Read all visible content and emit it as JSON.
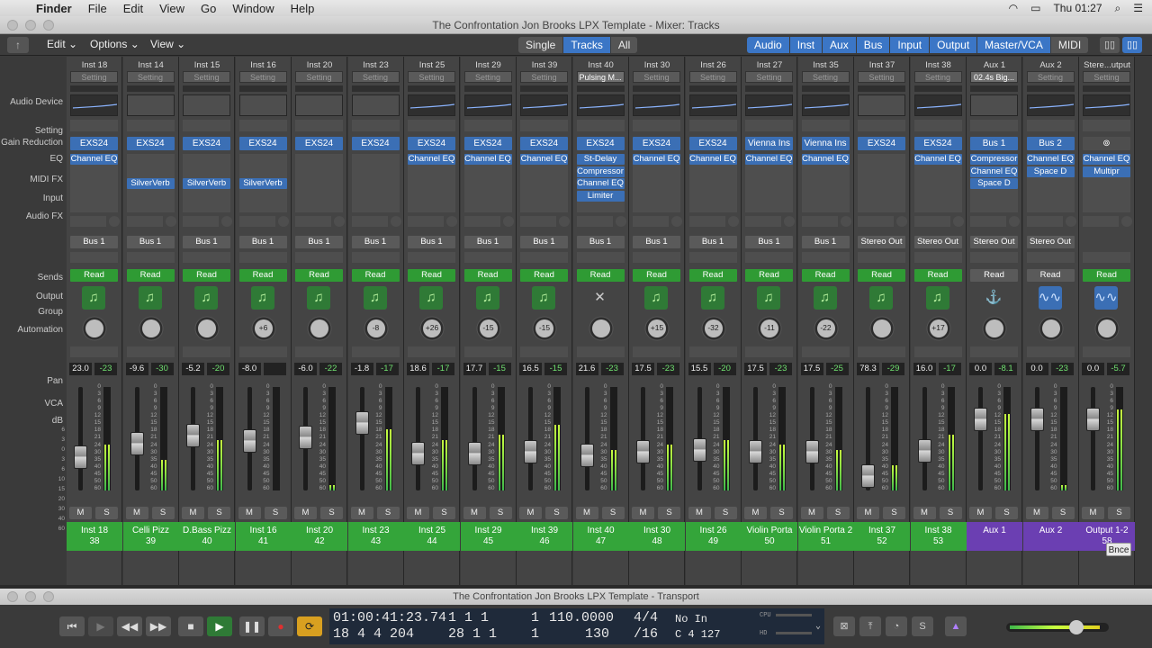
{
  "menubar": {
    "app": "Finder",
    "items": [
      "File",
      "Edit",
      "View",
      "Go",
      "Window",
      "Help"
    ],
    "clock": "Thu 01:27"
  },
  "mixer": {
    "window_title": "The Confrontation Jon Brooks LPX Template - Mixer: Tracks",
    "toolbar": {
      "edit": "Edit",
      "options": "Options",
      "view": "View",
      "modes": [
        "Single",
        "Tracks",
        "All"
      ],
      "active_mode": "Tracks",
      "filters": [
        "Audio",
        "Inst",
        "Aux",
        "Bus",
        "Input",
        "Output",
        "Master/VCA",
        "MIDI"
      ]
    },
    "row_labels": {
      "audio_device": "Audio Device",
      "setting": "Setting",
      "gain_reduction": "Gain Reduction",
      "eq": "EQ",
      "midi_fx": "MIDI FX",
      "input": "Input",
      "audio_fx": "Audio FX",
      "sends": "Sends",
      "output": "Output",
      "group": "Group",
      "automation": "Automation",
      "pan": "Pan",
      "vca": "VCA",
      "db": "dB"
    },
    "fader_scale": [
      "6",
      "3",
      "0",
      "3",
      "6",
      "10",
      "15",
      "20",
      "30",
      "40",
      "60"
    ],
    "meter_scale": [
      "0",
      "3",
      "6",
      "9",
      "12",
      "15",
      "18",
      "21",
      "24",
      "30",
      "35",
      "40",
      "45",
      "50",
      "60"
    ],
    "strips": [
      {
        "name": "Inst 18",
        "setting": "Setting",
        "eq": true,
        "input": "EXS24",
        "fx": [
          "Channel EQ"
        ],
        "output": "Bus 1",
        "automation": "Read",
        "icon": "note",
        "pan": "",
        "db": "23.0",
        "peak": "-23",
        "track": "Inst 18",
        "num": "38",
        "kind": "inst",
        "fader": 0.72,
        "meter": 0.45
      },
      {
        "name": "Inst 14",
        "setting": "Setting",
        "eq": false,
        "input": "EXS24",
        "fx": [
          "",
          "",
          "SilverVerb"
        ],
        "output": "Bus 1",
        "automation": "Read",
        "icon": "note",
        "pan": "",
        "db": "-9.6",
        "peak": "-30",
        "track": "Celli Pizz",
        "num": "39",
        "kind": "inst",
        "fader": 0.55,
        "meter": 0.3
      },
      {
        "name": "Inst 15",
        "setting": "Setting",
        "eq": false,
        "input": "EXS24",
        "fx": [
          "",
          "",
          "SilverVerb"
        ],
        "output": "Bus 1",
        "automation": "Read",
        "icon": "note",
        "pan": "",
        "db": "-5.2",
        "peak": "-20",
        "track": "D.Bass Pizz",
        "num": "40",
        "kind": "inst",
        "fader": 0.45,
        "meter": 0.5
      },
      {
        "name": "Inst 16",
        "setting": "Setting",
        "eq": false,
        "input": "EXS24",
        "fx": [
          "",
          "",
          "SilverVerb"
        ],
        "output": "Bus 1",
        "automation": "Read",
        "icon": "note",
        "pan": "+6",
        "db": "-8.0",
        "peak": "",
        "track": "Inst 16",
        "num": "41",
        "kind": "inst",
        "fader": 0.52,
        "meter": 0.0
      },
      {
        "name": "Inst 20",
        "setting": "Setting",
        "eq": false,
        "input": "EXS24",
        "fx": [],
        "output": "Bus 1",
        "automation": "Read",
        "icon": "note",
        "pan": "",
        "db": "-6.0",
        "peak": "-22",
        "track": "Inst 20",
        "num": "42",
        "kind": "inst",
        "fader": 0.48,
        "meter": 0.05
      },
      {
        "name": "Inst 23",
        "setting": "Setting",
        "eq": false,
        "input": "EXS24",
        "fx": [],
        "output": "Bus 1",
        "automation": "Read",
        "icon": "note",
        "pan": "-8",
        "db": "-1.8",
        "peak": "-17",
        "track": "Inst 23",
        "num": "43",
        "kind": "inst",
        "fader": 0.3,
        "meter": 0.6
      },
      {
        "name": "Inst 25",
        "setting": "Setting",
        "eq": true,
        "input": "EXS24",
        "fx": [
          "Channel EQ"
        ],
        "output": "Bus 1",
        "automation": "Read",
        "icon": "note",
        "pan": "+26",
        "db": "18.6",
        "peak": "-17",
        "track": "Inst 25",
        "num": "44",
        "kind": "inst",
        "fader": 0.68,
        "meter": 0.5
      },
      {
        "name": "Inst 29",
        "setting": "Setting",
        "eq": true,
        "input": "EXS24",
        "fx": [
          "Channel EQ"
        ],
        "output": "Bus 1",
        "automation": "Read",
        "icon": "note",
        "pan": "-15",
        "db": "17.7",
        "peak": "-15",
        "track": "Inst 29",
        "num": "45",
        "kind": "inst",
        "fader": 0.68,
        "meter": 0.55
      },
      {
        "name": "Inst 39",
        "setting": "Setting",
        "eq": true,
        "input": "EXS24",
        "fx": [
          "Channel EQ"
        ],
        "output": "Bus 1",
        "automation": "Read",
        "icon": "note",
        "pan": "-15",
        "db": "16.5",
        "peak": "-15",
        "track": "Inst 39",
        "num": "46",
        "kind": "inst",
        "fader": 0.66,
        "meter": 0.65
      },
      {
        "name": "Inst 40",
        "setting": "Pulsing M...",
        "eq": true,
        "input": "EXS24",
        "fx": [
          "St-Delay",
          "Compressor",
          "Channel EQ",
          "Limiter"
        ],
        "output": "Bus 1",
        "automation": "Read",
        "icon": "mute",
        "pan": "",
        "db": "21.6",
        "peak": "-23",
        "track": "Inst 40",
        "num": "47",
        "kind": "inst",
        "fader": 0.7,
        "meter": 0.4
      },
      {
        "name": "Inst 30",
        "setting": "Setting",
        "eq": true,
        "input": "EXS24",
        "fx": [
          "Channel EQ"
        ],
        "output": "Bus 1",
        "automation": "Read",
        "icon": "note",
        "pan": "+15",
        "db": "17.5",
        "peak": "-23",
        "track": "Inst 30",
        "num": "48",
        "kind": "inst",
        "fader": 0.66,
        "meter": 0.45
      },
      {
        "name": "Inst 26",
        "setting": "Setting",
        "eq": true,
        "input": "EXS24",
        "fx": [
          "Channel EQ"
        ],
        "output": "Bus 1",
        "automation": "Read",
        "icon": "note",
        "pan": "-32",
        "db": "15.5",
        "peak": "-20",
        "track": "Inst 26",
        "num": "49",
        "kind": "inst",
        "fader": 0.63,
        "meter": 0.5
      },
      {
        "name": "Inst 27",
        "setting": "Setting",
        "eq": true,
        "input": "Vienna Ins",
        "fx": [
          "Channel EQ"
        ],
        "output": "Bus 1",
        "automation": "Read",
        "icon": "note",
        "pan": "-11",
        "db": "17.5",
        "peak": "-23",
        "track": "Violin Porta",
        "num": "50",
        "kind": "inst",
        "fader": 0.66,
        "meter": 0.45
      },
      {
        "name": "Inst 35",
        "setting": "Setting",
        "eq": true,
        "input": "Vienna Ins",
        "fx": [
          "Channel EQ"
        ],
        "output": "Bus 1",
        "automation": "Read",
        "icon": "note",
        "pan": "-22",
        "db": "17.5",
        "peak": "-25",
        "track": "Violin Porta 2",
        "num": "51",
        "kind": "inst",
        "fader": 0.66,
        "meter": 0.4
      },
      {
        "name": "Inst 37",
        "setting": "Setting",
        "eq": false,
        "input": "EXS24",
        "fx": [],
        "output": "Stereo Out",
        "automation": "Read",
        "icon": "note",
        "pan": "",
        "db": "78.3",
        "peak": "-29",
        "track": "Inst 37",
        "num": "52",
        "kind": "inst",
        "fader": 0.95,
        "meter": 0.25
      },
      {
        "name": "Inst 38",
        "setting": "Setting",
        "eq": true,
        "input": "EXS24",
        "fx": [
          "Channel EQ"
        ],
        "output": "Stereo Out",
        "automation": "Read",
        "icon": "note",
        "pan": "+17",
        "db": "16.0",
        "peak": "-17",
        "track": "Inst 38",
        "num": "53",
        "kind": "inst",
        "fader": 0.64,
        "meter": 0.55
      },
      {
        "name": "Aux 1",
        "setting": "02.4s Big...",
        "eq": false,
        "input": "Bus 1",
        "fx": [
          "Compressor",
          "Channel EQ",
          "Space D"
        ],
        "output": "Stereo Out",
        "automation": "Read",
        "icon": "aux",
        "pan": "",
        "db": "0.0",
        "peak": "-8.1",
        "track": "Aux 1",
        "num": "",
        "kind": "aux",
        "fader": 0.25,
        "meter": 0.75
      },
      {
        "name": "Aux 2",
        "setting": "Setting",
        "eq": true,
        "input": "Bus 2",
        "fx": [
          "Channel EQ",
          "Space D"
        ],
        "output": "Stereo Out",
        "automation": "Read",
        "icon": "wave",
        "pan": "",
        "db": "0.0",
        "peak": "-23",
        "track": "Aux 2",
        "num": "",
        "kind": "aux",
        "fader": 0.25,
        "meter": 0.05
      },
      {
        "name": "Stere...utput",
        "setting": "Setting",
        "eq": true,
        "input": "",
        "fx": [
          "Channel EQ",
          "Multipr"
        ],
        "output": "",
        "automation": "Read",
        "icon": "wave",
        "pan": "",
        "db": "0.0",
        "peak": "-5.7",
        "track": "Output 1-2",
        "num": "58",
        "kind": "aux",
        "fader": 0.25,
        "meter": 0.8
      }
    ],
    "bounce": "Bnce"
  },
  "transport": {
    "window_title": "The Confrontation Jon Brooks LPX Template - Transport",
    "smpte": "01:00:41:23.74",
    "bars": "18  4  4  204",
    "pos1": "1   1   1",
    "pos1b": "1",
    "pos2": "28  1   1",
    "pos2b": "1",
    "tempo": "110.0000",
    "tempo2": "130",
    "sig": "4/4",
    "div": "/16",
    "in": "No In",
    "key": "C  4  127",
    "cpu": "CPU",
    "hd": "HD"
  }
}
